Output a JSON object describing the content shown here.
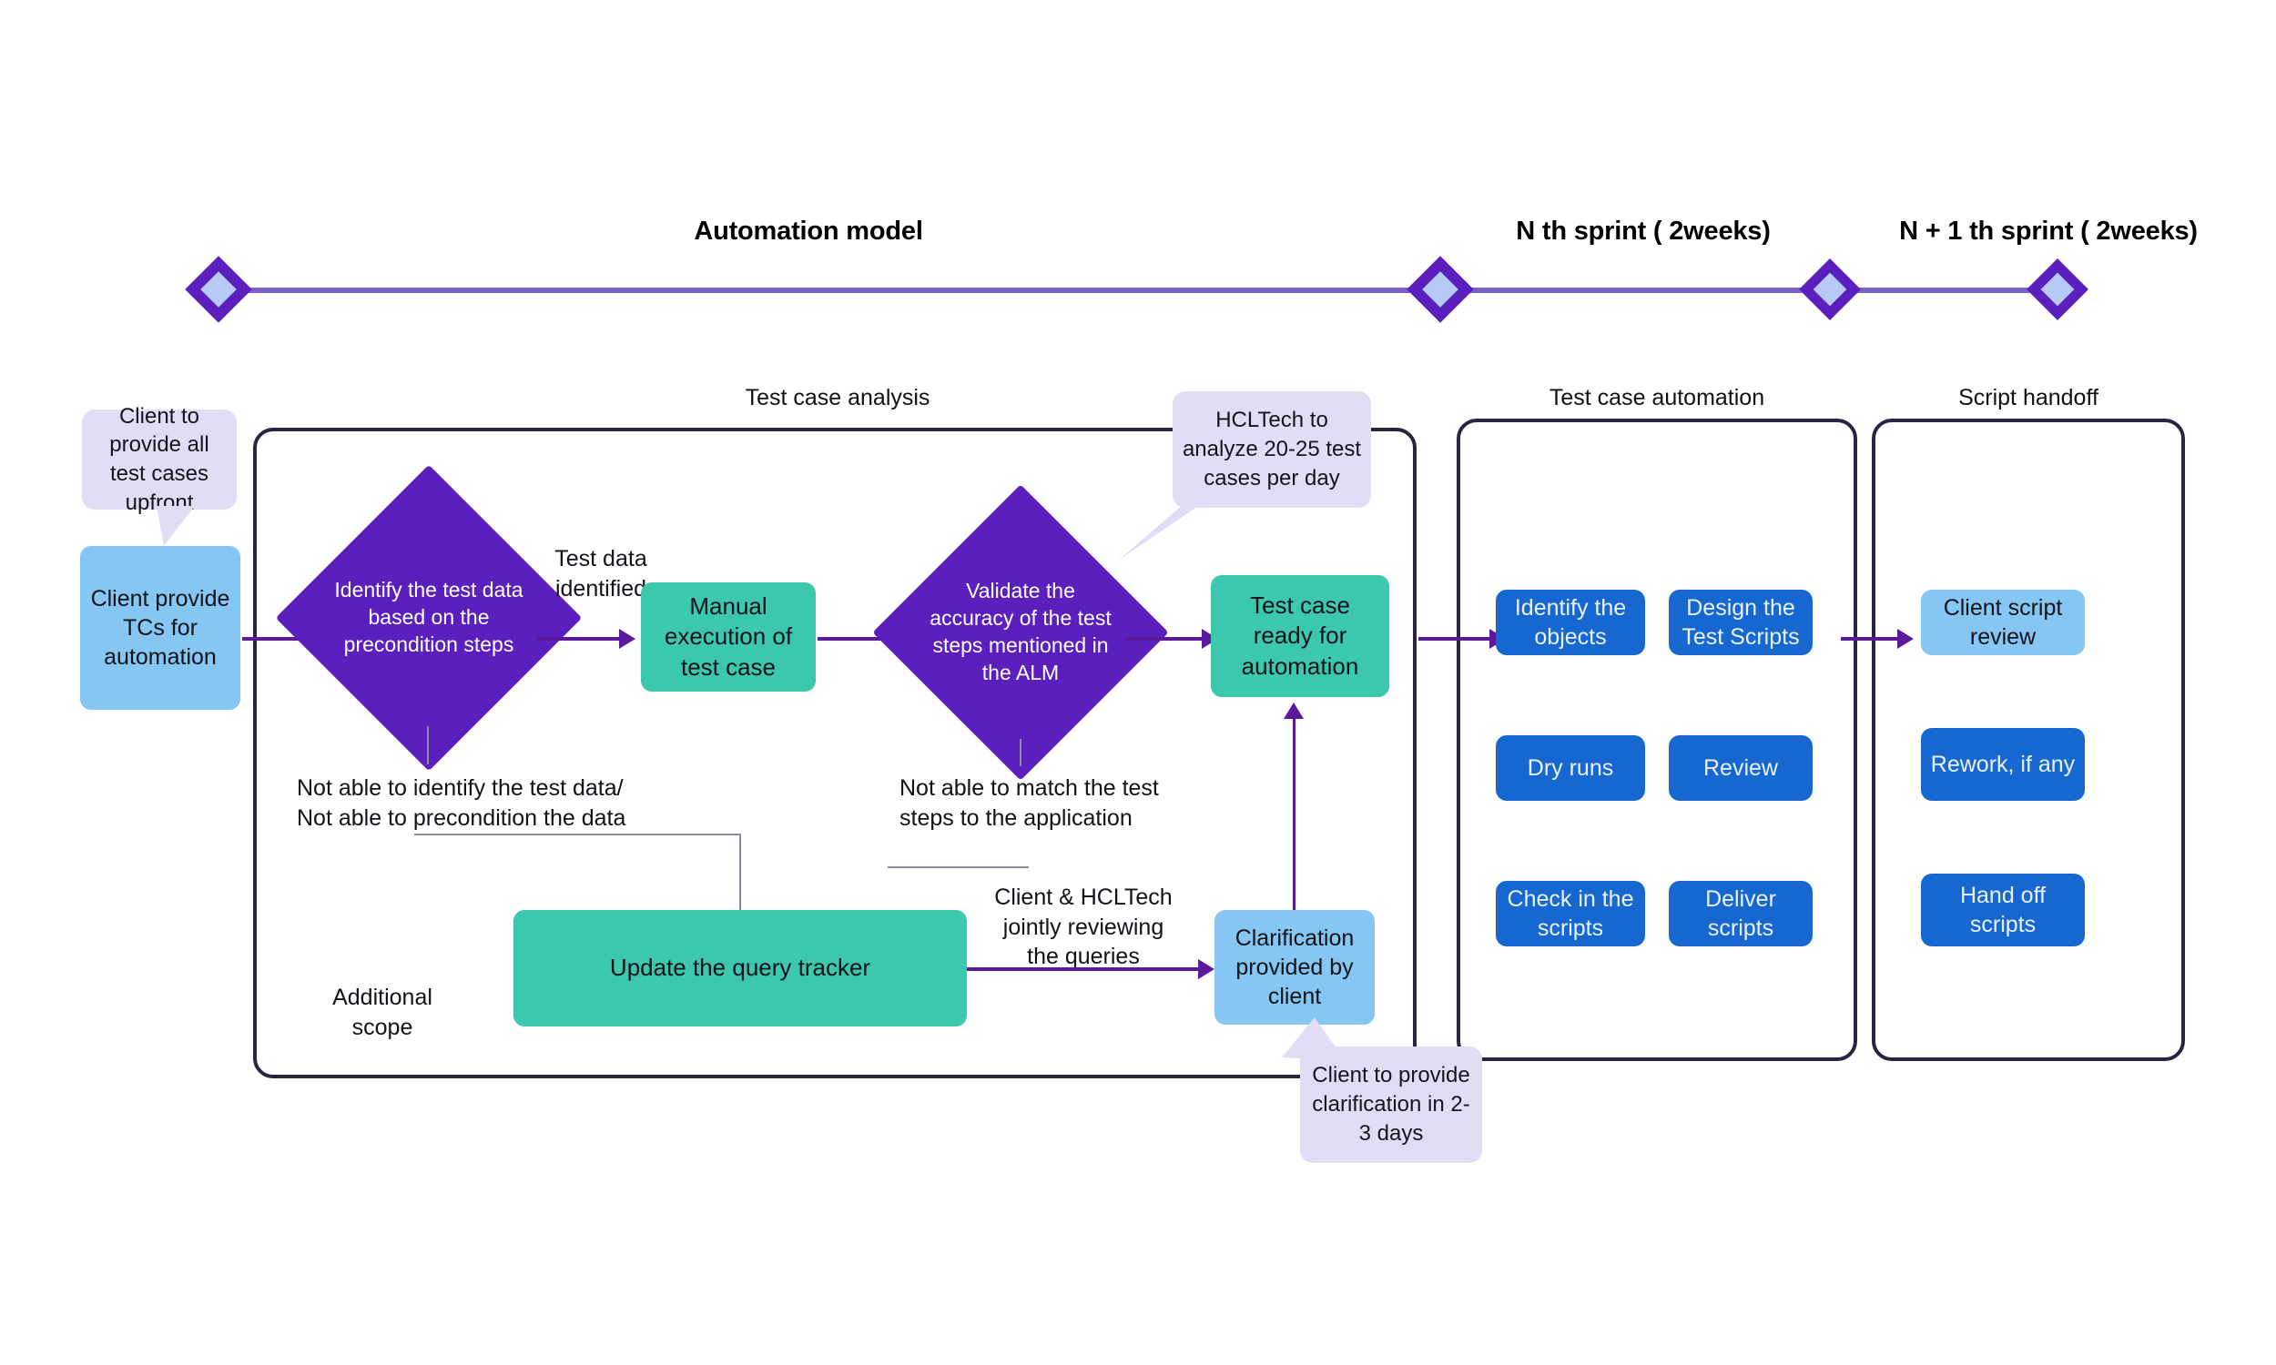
{
  "timeline": {
    "automation_model_title": "Automation model",
    "sprint_n_title": "N th sprint ( 2weeks)",
    "sprint_n1_title": "N + 1 th sprint ( 2weeks)"
  },
  "phases": {
    "test_case_analysis": "Test case analysis",
    "test_case_automation": "Test case automation",
    "script_handoff": "Script handoff"
  },
  "callouts": {
    "upfront": "Client to provide all test cases upfront",
    "hcltech_analyze": "HCLTech to analyze 20-25 test cases per day",
    "clarification_days": "Client to provide clarification in 2-3 days"
  },
  "nodes": {
    "client_provide_tcs": "Client provide TCs for automation",
    "identify_test_data": "Identify the test data based on the precondition steps",
    "manual_execution": "Manual execution of test case",
    "validate_accuracy": "Validate the accuracy of the test steps mentioned in the ALM",
    "test_case_ready": "Test case ready for automation",
    "update_query_tracker": "Update the query tracker",
    "clarification_by_client": "Clarification provided by client"
  },
  "edge_labels": {
    "test_data_identified": "Test data\nidentified",
    "not_able_identify": "Not able to identify the test data/\nNot able to precondition the data",
    "not_able_match": "Not able to match the test\nsteps to the application",
    "jointly_reviewing": "Client & HCLTech\njointly reviewing\nthe queries",
    "additional_scope": "Additional\nscope"
  },
  "automation_boxes": [
    {
      "label": "Identify the objects"
    },
    {
      "label": "Design the Test Scripts"
    },
    {
      "label": "Dry runs"
    },
    {
      "label": "Review"
    },
    {
      "label": "Check in the scripts"
    },
    {
      "label": "Deliver scripts"
    }
  ],
  "handoff_boxes": [
    {
      "label": "Client script review",
      "style": "light"
    },
    {
      "label": "Rework, if any",
      "style": "solid"
    },
    {
      "label": "Hand off scripts",
      "style": "solid"
    }
  ],
  "colors": {
    "purple": "#5b1fbd",
    "purple_line": "#7b62c9",
    "teal": "#3cc8ad",
    "light_blue": "#85c6f2",
    "blue": "#1668d0",
    "lavender": "#e2dcf5",
    "panel_border": "#2b2440",
    "connector": "#5b1a9c"
  }
}
